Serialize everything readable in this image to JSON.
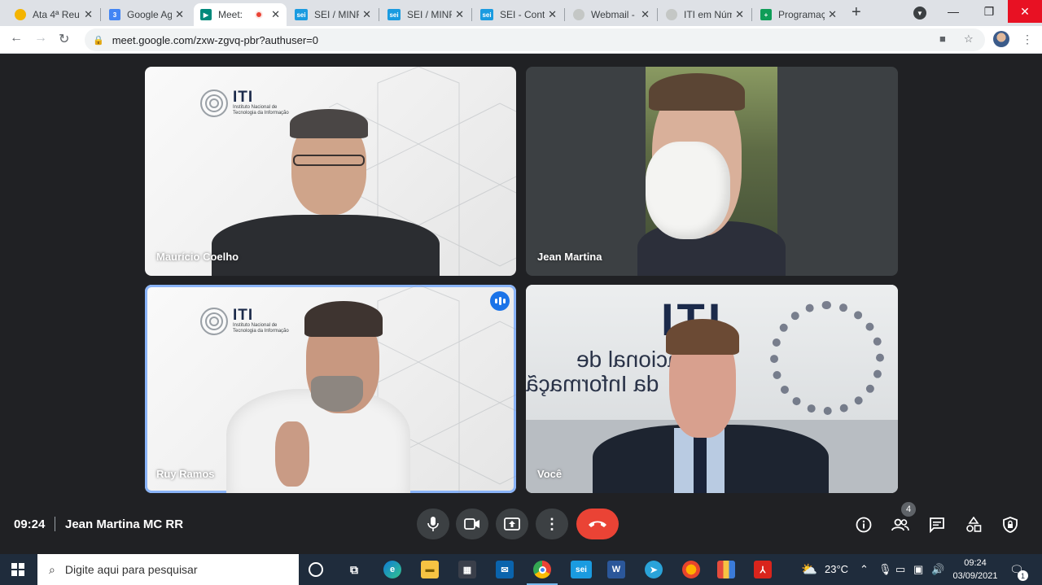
{
  "browser": {
    "tabs": [
      {
        "title": "Ata 4ª Reu",
        "favicon": "chrome-red-icon",
        "color": "#f4b400"
      },
      {
        "title": "Google Ag",
        "favicon": "calendar-icon",
        "color": "#4285f4"
      },
      {
        "title": "Meet:",
        "favicon": "meet-icon",
        "color": "#00897b",
        "active": true
      },
      {
        "title": "SEI / MINFI",
        "favicon": "sei-icon",
        "color": "#1a9be0"
      },
      {
        "title": "SEI / MINFI",
        "favicon": "sei-icon",
        "color": "#1a9be0"
      },
      {
        "title": "SEI - Contr",
        "favicon": "sei-icon",
        "color": "#1a9be0"
      },
      {
        "title": "Webmail -",
        "favicon": "webmail-icon",
        "color": "#9aa0a6"
      },
      {
        "title": "ITI em Núm",
        "favicon": "globe-icon",
        "color": "#9aa0a6"
      },
      {
        "title": "Programaç",
        "favicon": "sheets-icon",
        "color": "#0f9d58"
      }
    ],
    "url": "meet.google.com/zxw-zgvq-pbr?authuser=0"
  },
  "meet": {
    "tiles": [
      {
        "name": "Maurício Coelho"
      },
      {
        "name": "Jean Martina"
      },
      {
        "name": "Ruy Ramos",
        "speaking": true
      },
      {
        "name": "Você"
      }
    ],
    "logo": {
      "big": "ITI",
      "line1": "Instituto Nacional de",
      "line2": "Tecnologia da Informação"
    },
    "wall": {
      "line1": "acional de",
      "line2": "da Informaçã"
    },
    "time": "09:24",
    "meeting_name": "Jean Martina MC RR",
    "participants_count": "4"
  },
  "taskbar": {
    "search_placeholder": "Digite aqui para pesquisar",
    "weather": "23°C",
    "time": "09:24",
    "date": "03/09/2021",
    "notifications": "1"
  },
  "colors": {
    "accent": "#8ab4f8",
    "end_call": "#ea4335",
    "meet_bg": "#202124"
  }
}
